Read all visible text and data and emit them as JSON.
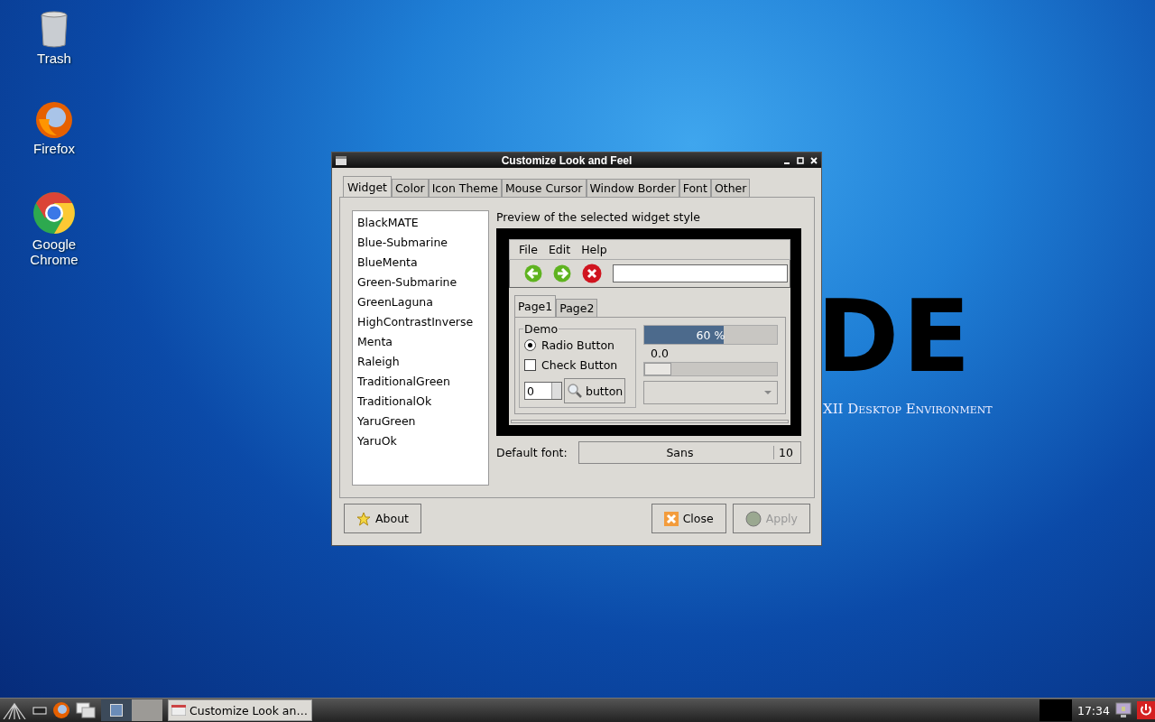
{
  "desktop_icons": [
    {
      "kind": "trash",
      "label": "Trash"
    },
    {
      "kind": "firefox",
      "label": "Firefox"
    },
    {
      "kind": "chrome",
      "label": "Google Chrome"
    }
  ],
  "wallpaper": {
    "logo": "DE",
    "tagline": "XII Desktop Environment"
  },
  "window": {
    "title": "Customize Look and Feel",
    "tabs": [
      {
        "label": "Widget",
        "selected": true
      },
      {
        "label": "Color",
        "selected": false
      },
      {
        "label": "Icon Theme",
        "selected": false
      },
      {
        "label": "Mouse Cursor",
        "selected": false
      },
      {
        "label": "Window Border",
        "selected": false
      },
      {
        "label": "Font",
        "selected": false
      },
      {
        "label": "Other",
        "selected": false
      }
    ],
    "themes": [
      {
        "name": "BlackMATE",
        "selected": false
      },
      {
        "name": "Blue-Submarine",
        "selected": false
      },
      {
        "name": "BlueMenta",
        "selected": false
      },
      {
        "name": "Green-Submarine",
        "selected": false
      },
      {
        "name": "GreenLaguna",
        "selected": false
      },
      {
        "name": "HighContrastInverse",
        "selected": false
      },
      {
        "name": "Menta",
        "selected": false
      },
      {
        "name": "Raleigh",
        "selected": false
      },
      {
        "name": "TraditionalGreen",
        "selected": false
      },
      {
        "name": "TraditionalOk",
        "selected": false
      },
      {
        "name": "YaruGreen",
        "selected": false
      },
      {
        "name": "YaruOk",
        "selected": false
      }
    ],
    "preview_label": "Preview of the selected widget style",
    "preview": {
      "menu": [
        "File",
        "Edit",
        "Help"
      ],
      "pages": [
        {
          "label": "Page1",
          "selected": true
        },
        {
          "label": "Page2",
          "selected": false
        }
      ],
      "frame_label": "Demo",
      "radio": {
        "label": "Radio Button",
        "selected": true
      },
      "check": {
        "label": "Check Button",
        "checked": false
      },
      "spin_value": "0",
      "button": "button",
      "progress": {
        "level": 0.6,
        "text": "60 %"
      },
      "scale": {
        "reading": "0.0",
        "level": 0
      }
    },
    "font_label": "Default font:",
    "font_name": "Sans",
    "font_size": "10",
    "buttons": [
      {
        "kind": "about",
        "label": "About",
        "disabled": false
      },
      {
        "kind": "close",
        "label": "Close",
        "disabled": false
      },
      {
        "kind": "apply",
        "label": "Apply",
        "disabled": true
      }
    ]
  },
  "taskbar": {
    "task": "Customize Look an…",
    "clock": "17:34"
  }
}
